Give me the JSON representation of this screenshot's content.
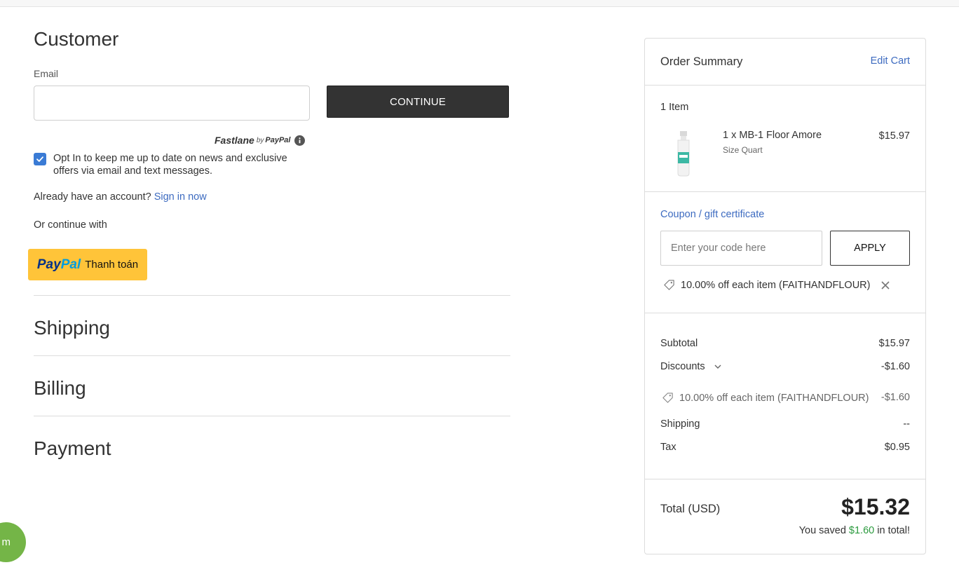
{
  "customer": {
    "title": "Customer",
    "email_label": "Email",
    "email_value": "",
    "email_placeholder": "",
    "continue_label": "CONTINUE",
    "fastlane": {
      "name": "Fastlane",
      "by": "by",
      "brand": "PayPal"
    },
    "optin_text": "Opt In to keep me up to date on news and exclusive offers via email and text messages.",
    "optin_checked": true,
    "account_prompt": "Already have an account?",
    "sign_in_label": "Sign in now",
    "or_continue": "Or continue with",
    "paypal_pay": "Pay",
    "paypal_pal": "Pal",
    "paypal_label": "Thanh toán"
  },
  "sections": {
    "shipping": "Shipping",
    "billing": "Billing",
    "payment": "Payment"
  },
  "chat_bubble_text": "m",
  "summary": {
    "title": "Order Summary",
    "edit_cart": "Edit Cart",
    "items_count": "1 Item",
    "product": {
      "name": "1 x MB-1 Floor Amore",
      "option": "Size Quart",
      "price": "$15.97"
    },
    "coupon_link": "Coupon / gift certificate",
    "coupon_placeholder": "Enter your code here",
    "apply_label": "APPLY",
    "applied_coupon": "10.00% off each item (FAITHANDFLOUR)",
    "subtotal_label": "Subtotal",
    "subtotal_value": "$15.97",
    "discounts_label": "Discounts",
    "discounts_value": "-$1.60",
    "discount_detail_label": "10.00% off each item (FAITHANDFLOUR)",
    "discount_detail_value": "-$1.60",
    "shipping_label": "Shipping",
    "shipping_value": "--",
    "tax_label": "Tax",
    "tax_value": "$0.95",
    "total_label": "Total (USD)",
    "total_value": "$15.32",
    "saved_prefix": "You saved",
    "saved_amount": "$1.60",
    "saved_suffix": "in total!"
  },
  "colors": {
    "link": "#3d6bc0",
    "checkbox": "#3a7bd5",
    "continue_bg": "#333333",
    "paypal_bg": "#ffc439",
    "saved": "#2b9a3e",
    "chat_bubble": "#74b547"
  }
}
